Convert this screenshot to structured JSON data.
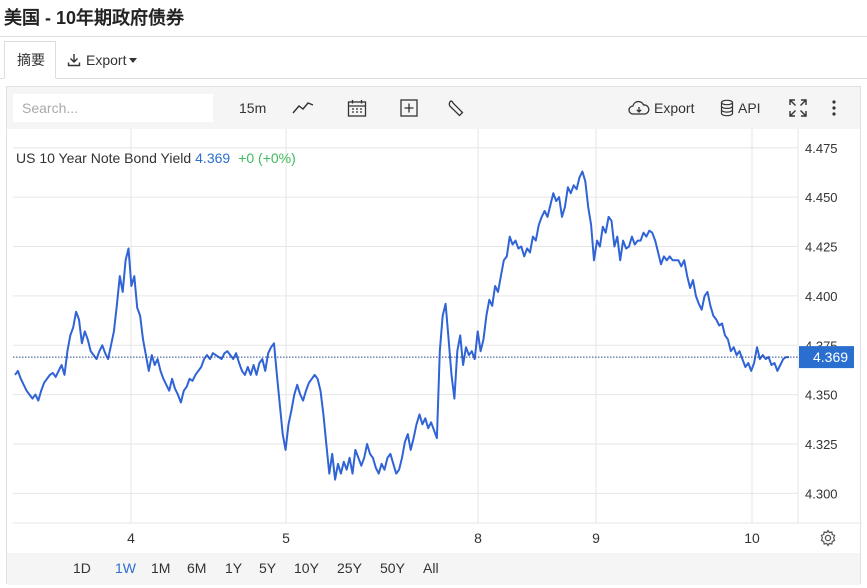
{
  "page": {
    "title": "美国 - 10年期政府债券"
  },
  "tabs": {
    "summary_label": "摘要",
    "export_label": "Export"
  },
  "toolbar": {
    "search_placeholder": "Search...",
    "interval_label": "15m",
    "export_label": "Export",
    "api_label": "API"
  },
  "legend": {
    "name": "US 10 Year Note Bond Yield",
    "value": "4.369",
    "change": "+0 (+0%)"
  },
  "range_buttons": [
    {
      "label": "1D",
      "active": false
    },
    {
      "label": "1W",
      "active": true
    },
    {
      "label": "1M",
      "active": false
    },
    {
      "label": "6M",
      "active": false
    },
    {
      "label": "1Y",
      "active": false
    },
    {
      "label": "5Y",
      "active": false
    },
    {
      "label": "10Y",
      "active": false
    },
    {
      "label": "25Y",
      "active": false
    },
    {
      "label": "50Y",
      "active": false
    },
    {
      "label": "All",
      "active": false
    }
  ],
  "colors": {
    "line": "#2f63d6",
    "price_tag_bg": "#2a6fd0",
    "up": "#3dba5d",
    "grid": "#e6e6e6"
  },
  "chart_data": {
    "type": "line",
    "title": "US 10 Year Note Bond Yield",
    "ylim": [
      4.285,
      4.4845
    ],
    "y_ticks": [
      4.3,
      4.325,
      4.35,
      4.375,
      4.4,
      4.425,
      4.45,
      4.475
    ],
    "y_tick_labels": [
      "4.300",
      "4.325",
      "4.350",
      "4.375",
      "4.400",
      "4.425",
      "4.450",
      "4.475"
    ],
    "x_ticks": [
      "4",
      "5",
      "8",
      "9",
      "10"
    ],
    "last_value": 4.369,
    "last_value_label": "4.369",
    "series": [
      {
        "values": [
          4.36,
          4.362,
          4.358,
          4.355,
          4.352,
          4.35,
          4.348,
          4.35,
          4.347,
          4.352,
          4.356,
          4.358,
          4.36,
          4.361,
          4.359,
          4.362,
          4.365,
          4.36,
          4.372,
          4.38,
          4.384,
          4.392,
          4.388,
          4.376,
          4.382,
          4.378,
          4.372,
          4.37,
          4.368,
          4.372,
          4.375,
          4.371,
          4.368,
          4.375,
          4.382,
          4.395,
          4.41,
          4.402,
          4.418,
          4.424,
          4.405,
          4.41,
          4.394,
          4.39,
          4.378,
          4.37,
          4.362,
          4.37,
          4.365,
          4.368,
          4.362,
          4.358,
          4.355,
          4.352,
          4.358,
          4.353,
          4.35,
          4.346,
          4.352,
          4.354,
          4.358,
          4.357,
          4.36,
          4.362,
          4.364,
          4.368,
          4.37,
          4.368,
          4.371,
          4.37,
          4.369,
          4.368,
          4.371,
          4.372,
          4.37,
          4.368,
          4.371,
          4.366,
          4.362,
          4.36,
          4.364,
          4.36,
          4.365,
          4.36,
          4.366,
          4.368,
          4.362,
          4.371,
          4.374,
          4.376,
          4.36,
          4.345,
          4.33,
          4.322,
          4.335,
          4.342,
          4.35,
          4.355,
          4.35,
          4.347,
          4.352,
          4.356,
          4.358,
          4.36,
          4.358,
          4.352,
          4.34,
          4.325,
          4.31,
          4.32,
          4.307,
          4.315,
          4.31,
          4.316,
          4.312,
          4.318,
          4.31,
          4.322,
          4.318,
          4.314,
          4.318,
          4.325,
          4.32,
          4.318,
          4.313,
          4.31,
          4.315,
          4.312,
          4.318,
          4.32,
          4.315,
          4.31,
          4.312,
          4.318,
          4.326,
          4.33,
          4.322,
          4.328,
          4.335,
          4.34,
          4.335,
          4.338,
          4.333,
          4.336,
          4.332,
          4.328,
          4.372,
          4.39,
          4.396,
          4.378,
          4.36,
          4.348,
          4.372,
          4.38,
          4.365,
          4.374,
          4.37,
          4.372,
          4.368,
          4.382,
          4.372,
          4.378,
          4.39,
          4.398,
          4.395,
          4.405,
          4.402,
          4.41,
          4.418,
          4.42,
          4.43,
          4.426,
          4.428,
          4.424,
          4.425,
          4.42,
          4.424,
          4.422,
          4.43,
          4.428,
          4.436,
          4.44,
          4.443,
          4.44,
          4.446,
          4.452,
          4.448,
          4.45,
          4.44,
          4.445,
          4.455,
          4.452,
          4.456,
          4.454,
          4.46,
          4.463,
          4.458,
          4.445,
          4.436,
          4.418,
          4.428,
          4.425,
          4.435,
          4.432,
          4.44,
          4.438,
          4.425,
          4.43,
          4.418,
          4.428,
          4.424,
          4.425,
          4.43,
          4.426,
          4.428,
          4.428,
          4.432,
          4.43,
          4.433,
          4.432,
          4.428,
          4.422,
          4.416,
          4.42,
          4.418,
          4.42,
          4.418,
          4.418,
          4.418,
          4.415,
          4.418,
          4.41,
          4.404,
          4.408,
          4.4,
          4.396,
          4.393,
          4.4,
          4.402,
          4.395,
          4.39,
          4.388,
          4.385,
          4.386,
          4.38,
          4.378,
          4.372,
          4.374,
          4.37,
          4.372,
          4.368,
          4.364,
          4.366,
          4.362,
          4.366,
          4.374,
          4.368,
          4.37,
          4.368,
          4.369,
          4.365,
          4.366,
          4.362,
          4.365,
          4.368,
          4.369,
          4.369
        ]
      }
    ]
  }
}
